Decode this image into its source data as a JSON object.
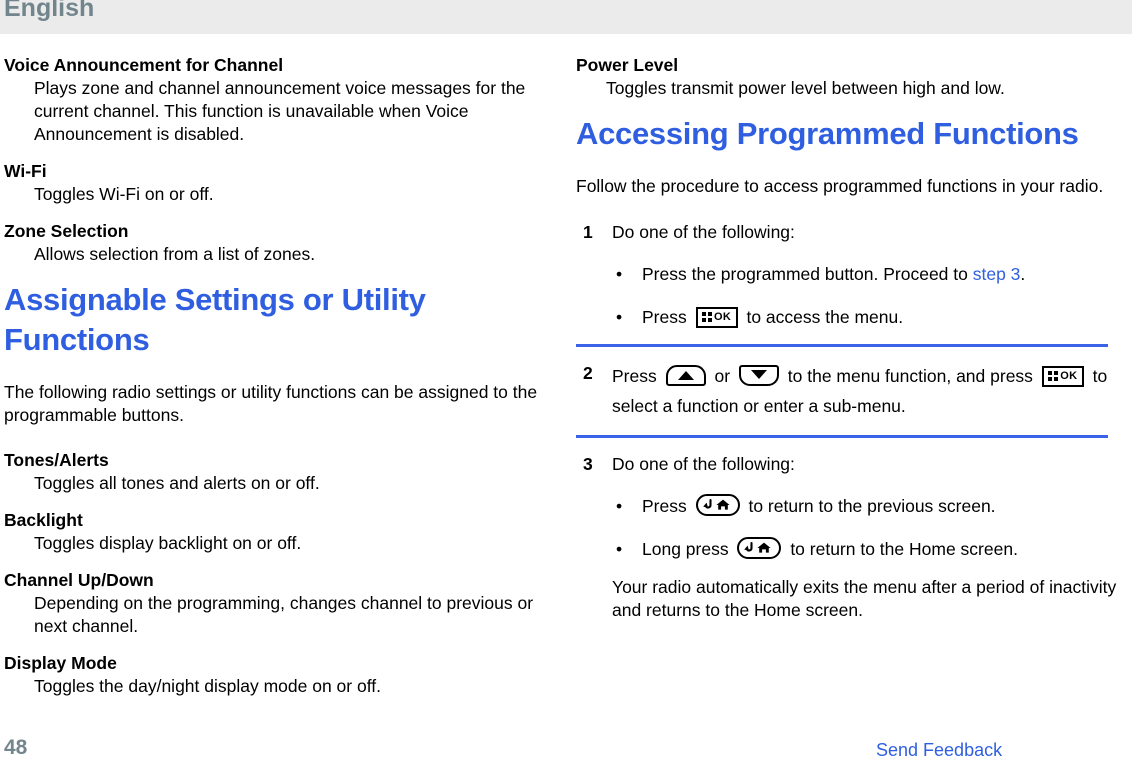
{
  "header": {
    "language_label": "English",
    "band_color": "#ebebeb",
    "text_color": "#72858d"
  },
  "theme": {
    "heading_blue": "#2f5fe0",
    "rule_blue": "#3b63e8",
    "link_blue": "#2f5fe0",
    "page_number_color": "#73858d"
  },
  "left_column": {
    "definitions_top": [
      {
        "term": "Voice Announcement for Channel",
        "description": "Plays zone and channel announcement voice messages for the current channel. This function is unavailable when Voice Announcement is disabled."
      },
      {
        "term": "Wi-Fi",
        "description": "Toggles Wi-Fi on or off."
      },
      {
        "term": "Zone Selection",
        "description": "Allows selection from a list of zones."
      }
    ],
    "section_heading": "Assignable Settings or Utility Functions",
    "intro_paragraph": "The following radio settings or utility functions can be assigned to the programmable buttons.",
    "definitions_bottom": [
      {
        "term": "Tones/Alerts",
        "description": "Toggles all tones and alerts on or off."
      },
      {
        "term": "Backlight",
        "description": "Toggles display backlight on or off."
      },
      {
        "term": "Channel Up/Down",
        "description": "Depending on the programming, changes channel to previous or next channel."
      },
      {
        "term": "Display Mode",
        "description": "Toggles the day/night display mode on or off."
      }
    ]
  },
  "right_column": {
    "definitions_top": [
      {
        "term": "Power Level",
        "description": "Toggles transmit power level between high and low."
      }
    ],
    "section_heading": "Accessing Programmed Functions",
    "intro_paragraph": "Follow the procedure to access programmed functions in your radio.",
    "steps": [
      {
        "number": "1",
        "text": "Do one of the following:",
        "substeps": [
          {
            "bullet": "•",
            "parts": [
              {
                "type": "text",
                "value": "Press the programmed button. Proceed to "
              },
              {
                "type": "link",
                "value": "step 3"
              },
              {
                "type": "text",
                "value": "."
              }
            ]
          },
          {
            "bullet": "•",
            "parts": [
              {
                "type": "text",
                "value": "Press "
              },
              {
                "type": "icon",
                "value": "menu-ok-key"
              },
              {
                "type": "text",
                "value": " to access the menu."
              }
            ]
          }
        ]
      },
      {
        "number": "2",
        "parts": [
          {
            "type": "text",
            "value": "Press "
          },
          {
            "type": "icon",
            "value": "up-arrow-key"
          },
          {
            "type": "text",
            "value": " or "
          },
          {
            "type": "icon",
            "value": "down-arrow-key"
          },
          {
            "type": "text",
            "value": " to the menu function, and press "
          },
          {
            "type": "icon",
            "value": "menu-ok-key"
          },
          {
            "type": "text",
            "value": " to select a function or enter a sub-menu."
          }
        ]
      },
      {
        "number": "3",
        "text": "Do one of the following:",
        "substeps": [
          {
            "bullet": "•",
            "parts": [
              {
                "type": "text",
                "value": "Press "
              },
              {
                "type": "icon",
                "value": "back-home-key"
              },
              {
                "type": "text",
                "value": " to return to the previous screen."
              }
            ]
          },
          {
            "bullet": "•",
            "parts": [
              {
                "type": "text",
                "value": "Long press "
              },
              {
                "type": "icon",
                "value": "back-home-key"
              },
              {
                "type": "text",
                "value": " to return to the Home screen."
              }
            ]
          }
        ],
        "note": "Your radio automatically exits the menu after a period of inactivity and returns to the Home screen."
      }
    ]
  },
  "footer": {
    "page_number": "48",
    "send_feedback_label": "Send Feedback"
  },
  "icons": {
    "menu-ok-key": {
      "label": "OK",
      "name": "menu-ok-key-icon"
    },
    "up-arrow-key": {
      "name": "up-arrow-key-icon"
    },
    "down-arrow-key": {
      "name": "down-arrow-key-icon"
    },
    "back-home-key": {
      "name": "back-home-key-icon"
    }
  }
}
